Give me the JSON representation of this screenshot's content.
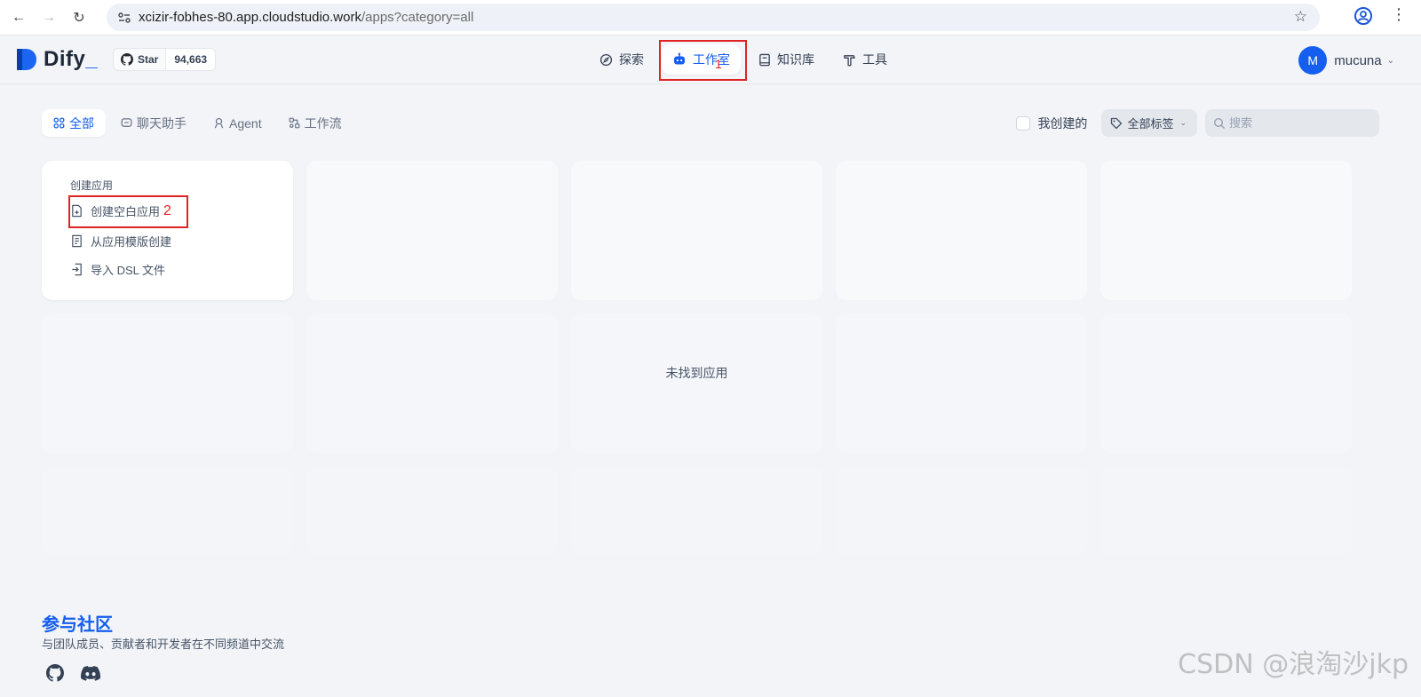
{
  "browser": {
    "url_host": "xcizir-fobhes-80.app.cloudstudio.work",
    "url_path": "/apps?category=all"
  },
  "header": {
    "logo_text": "Dify",
    "logo_cursor": "_",
    "github": {
      "star_label": "Star",
      "star_count": "94,663"
    },
    "nav": [
      {
        "label": "探索",
        "icon": "compass-icon"
      },
      {
        "label": "工作室",
        "icon": "robot-icon",
        "active": true
      },
      {
        "label": "知识库",
        "icon": "book-icon"
      },
      {
        "label": "工具",
        "icon": "hammer-icon"
      }
    ],
    "user": {
      "avatar_initial": "M",
      "name": "mucuna"
    }
  },
  "annotations": {
    "marker_1": "1",
    "marker_2": "2"
  },
  "filter_tabs": [
    {
      "label": "全部",
      "icon": "grid-icon",
      "active": true
    },
    {
      "label": "聊天助手",
      "icon": "chat-icon"
    },
    {
      "label": "Agent",
      "icon": "agent-icon"
    },
    {
      "label": "工作流",
      "icon": "workflow-icon"
    }
  ],
  "filters": {
    "mine_label": "我创建的",
    "tags_label": "全部标签",
    "search_placeholder": "搜索"
  },
  "create_card": {
    "title": "创建应用",
    "items": [
      {
        "label": "创建空白应用",
        "icon": "file-plus-icon"
      },
      {
        "label": "从应用模版创建",
        "icon": "file-template-icon"
      },
      {
        "label": "导入 DSL 文件",
        "icon": "import-icon"
      }
    ]
  },
  "empty_state": "未找到应用",
  "community": {
    "title": "参与社区",
    "description": "与团队成员、贡献者和开发者在不同频道中交流",
    "links": [
      {
        "icon": "github-icon"
      },
      {
        "icon": "discord-icon"
      }
    ]
  },
  "watermark": "CSDN @浪淘沙jkp",
  "colors": {
    "accent": "#155eef",
    "annotation": "#e02424",
    "background": "#f2f4f7"
  }
}
